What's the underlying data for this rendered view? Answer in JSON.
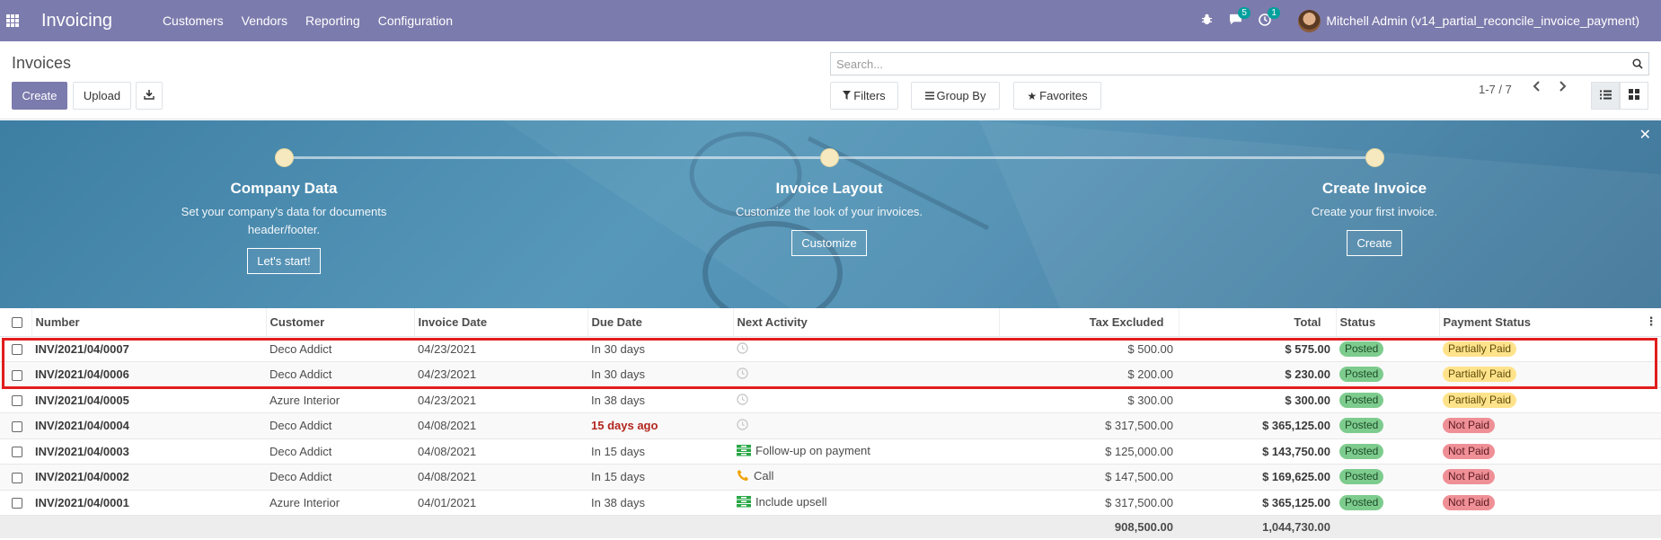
{
  "navbar": {
    "app_name": "Invoicing",
    "menu": [
      "Customers",
      "Vendors",
      "Reporting",
      "Configuration"
    ],
    "messages_count": "5",
    "activities_count": "1",
    "user_name": "Mitchell Admin (v14_partial_reconcile_invoice_payment)"
  },
  "control_panel": {
    "title": "Invoices",
    "create_label": "Create",
    "upload_label": "Upload",
    "search_placeholder": "Search...",
    "filters_label": "Filters",
    "groupby_label": "Group By",
    "favorites_label": "Favorites",
    "pager": "1-7 / 7"
  },
  "banner": {
    "steps": [
      {
        "title": "Company Data",
        "desc": "Set your company's data for documents header/footer.",
        "button": "Let's start!"
      },
      {
        "title": "Invoice Layout",
        "desc": "Customize the look of your invoices.",
        "button": "Customize"
      },
      {
        "title": "Create Invoice",
        "desc": "Create your first invoice.",
        "button": "Create"
      }
    ]
  },
  "table": {
    "columns": [
      "Number",
      "Customer",
      "Invoice Date",
      "Due Date",
      "Next Activity",
      "Tax Excluded",
      "Total",
      "Status",
      "Payment Status"
    ],
    "rows": [
      {
        "number": "INV/2021/04/0007",
        "customer": "Deco Addict",
        "invoice_date": "04/23/2021",
        "due_date": "In 30 days",
        "overdue": false,
        "activity": "",
        "activity_icon": "clock-icon",
        "tax_excluded": "$ 500.00",
        "total": "$ 575.00",
        "status": "Posted",
        "payment_status": "Partially Paid"
      },
      {
        "number": "INV/2021/04/0006",
        "customer": "Deco Addict",
        "invoice_date": "04/23/2021",
        "due_date": "In 30 days",
        "overdue": false,
        "activity": "",
        "activity_icon": "clock-icon",
        "tax_excluded": "$ 200.00",
        "total": "$ 230.00",
        "status": "Posted",
        "payment_status": "Partially Paid"
      },
      {
        "number": "INV/2021/04/0005",
        "customer": "Azure Interior",
        "invoice_date": "04/23/2021",
        "due_date": "In 38 days",
        "overdue": false,
        "activity": "",
        "activity_icon": "clock-icon",
        "tax_excluded": "$ 300.00",
        "total": "$ 300.00",
        "status": "Posted",
        "payment_status": "Partially Paid"
      },
      {
        "number": "INV/2021/04/0004",
        "customer": "Deco Addict",
        "invoice_date": "04/08/2021",
        "due_date": "15 days ago",
        "overdue": true,
        "activity": "",
        "activity_icon": "clock-icon",
        "tax_excluded": "$ 317,500.00",
        "total": "$ 365,125.00",
        "status": "Posted",
        "payment_status": "Not Paid"
      },
      {
        "number": "INV/2021/04/0003",
        "customer": "Deco Addict",
        "invoice_date": "04/08/2021",
        "due_date": "In 15 days",
        "overdue": false,
        "activity": "Follow-up on payment",
        "activity_icon": "money-icon",
        "tax_excluded": "$ 125,000.00",
        "total": "$ 143,750.00",
        "status": "Posted",
        "payment_status": "Not Paid"
      },
      {
        "number": "INV/2021/04/0002",
        "customer": "Deco Addict",
        "invoice_date": "04/08/2021",
        "due_date": "In 15 days",
        "overdue": false,
        "activity": "Call",
        "activity_icon": "phone-icon",
        "tax_excluded": "$ 147,500.00",
        "total": "$ 169,625.00",
        "status": "Posted",
        "payment_status": "Not Paid"
      },
      {
        "number": "INV/2021/04/0001",
        "customer": "Azure Interior",
        "invoice_date": "04/01/2021",
        "due_date": "In 38 days",
        "overdue": false,
        "activity": "Include upsell",
        "activity_icon": "money-icon",
        "tax_excluded": "$ 317,500.00",
        "total": "$ 365,125.00",
        "status": "Posted",
        "payment_status": "Not Paid"
      }
    ],
    "totals": {
      "tax_excluded": "908,500.00",
      "total": "1,044,730.00"
    }
  },
  "colors": {
    "brand": "#7c7bad",
    "posted": "#7dcc8e",
    "partially_paid": "#ffe38b",
    "not_paid": "#ef8f96",
    "overdue": "#b3261e",
    "highlight": "#e11d1d"
  }
}
